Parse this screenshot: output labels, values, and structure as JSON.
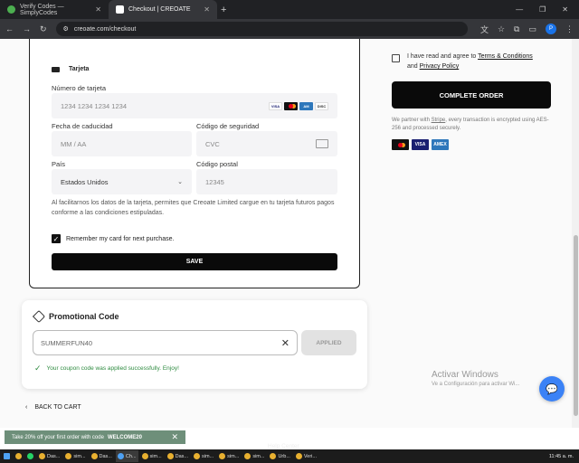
{
  "browser": {
    "tabs": [
      {
        "title": "Verify Codes — SimplyCodes",
        "active": false
      },
      {
        "title": "Checkout | CREOATE",
        "active": true
      }
    ],
    "url": "creoate.com/checkout",
    "profile_initial": "P"
  },
  "card_form": {
    "section_title": "Tarjeta",
    "card_number": {
      "label": "Número de tarjeta",
      "placeholder": "1234 1234 1234 1234"
    },
    "brands": [
      "VISA",
      "MC",
      "AMEX",
      "DISC"
    ],
    "expiry": {
      "label": "Fecha de caducidad",
      "placeholder": "MM / AA"
    },
    "security": {
      "label": "Código de seguridad",
      "placeholder": "CVC"
    },
    "country": {
      "label": "País",
      "value": "Estados Unidos"
    },
    "postal": {
      "label": "Código postal",
      "placeholder": "12345"
    },
    "disclaimer": "Al facilitarnos los datos de la tarjeta, permites que Creoate Limited cargue en tu tarjeta futuros pagos conforme a las condiciones estipuladas.",
    "remember_label": "Remember my card for next purchase.",
    "remember_checked": true,
    "save_label": "SAVE"
  },
  "promo": {
    "title": "Promotional Code",
    "code_value": "SUMMERFUN40",
    "applied_label": "APPLIED",
    "success_message": "Your coupon code was applied successfully. Enjoy!"
  },
  "back_label": "BACK TO CART",
  "order": {
    "terms_prefix": "I have read and agree to",
    "terms_link": "Terms & Conditions",
    "terms_and": "and",
    "privacy_link": "Privacy Policy",
    "complete_label": "COMPLETE ORDER",
    "stripe_note_1": "We partner with",
    "stripe_link": "Stripe",
    "stripe_note_2": ", every transaction is encrypted using AES-256 and processed securely."
  },
  "windows_watermark": {
    "line1": "Activar Windows",
    "line2": "Ve a Configuración para activar Wi..."
  },
  "banner": {
    "text": "Take 20% off your first order with code",
    "code": "WELCOME20"
  },
  "help_center": "Help Center",
  "taskbar": {
    "items": [
      "Das...",
      "sim...",
      "Das...",
      "Ch...",
      "sim...",
      "Das...",
      "sim...",
      "sim...",
      "sim...",
      "sim...",
      "sim...",
      "Urb...",
      "sim...",
      "Veri...",
      "Veri..."
    ],
    "time": "11:45 a. m."
  },
  "colors": {
    "accent": "#0a0a0a",
    "success": "#2e8b40",
    "banner": "#6e8f7a",
    "chat": "#3b82f6"
  }
}
